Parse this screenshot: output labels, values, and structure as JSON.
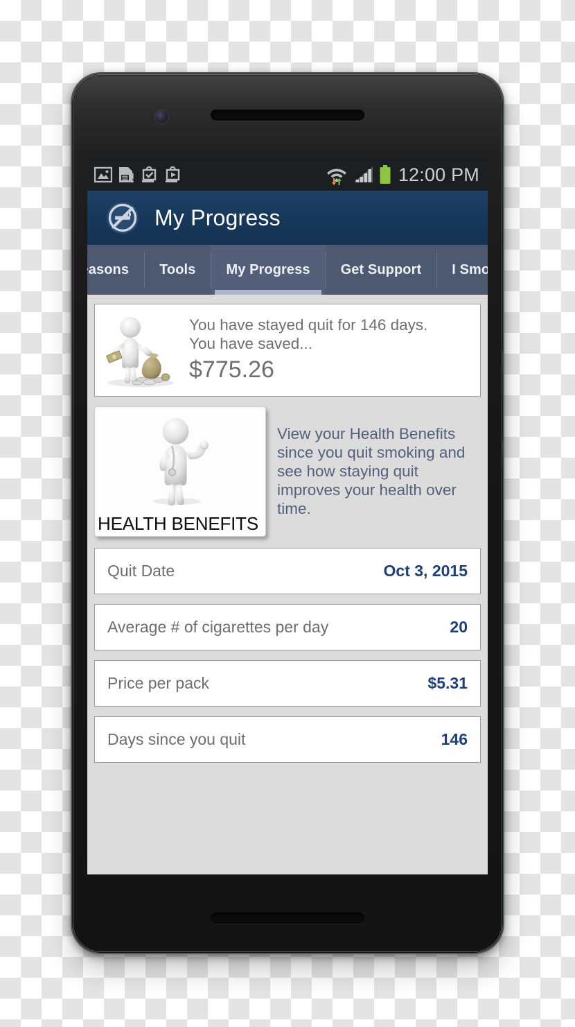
{
  "device": {
    "camera_icon": "front-camera",
    "speaker_icon": "earpiece-speaker"
  },
  "statusbar": {
    "time": "12:00 PM",
    "left_icons": [
      "gallery-image-icon",
      "sim-card-warning-icon",
      "update-check-bag-icon",
      "play-store-bag-icon"
    ],
    "right_icons": [
      "wifi-transfer-icon",
      "cell-signal-icon",
      "battery-full-icon"
    ],
    "colors": {
      "background": "#1c1f22",
      "text": "#cdd0d2",
      "battery": "#8ec63f",
      "arrow_down": "#f0932b",
      "arrow_up": "#7ec13f"
    }
  },
  "appbar": {
    "title": "My Progress",
    "logo_icon": "no-smoking-icon",
    "color": "#17375a"
  },
  "tabs": [
    {
      "label": "Reasons",
      "active": false,
      "partial": true
    },
    {
      "label": "Tools",
      "active": false,
      "partial": false
    },
    {
      "label": "My Progress",
      "active": true,
      "partial": false
    },
    {
      "label": "Get Support",
      "active": false,
      "partial": false
    },
    {
      "label": "I Smoke",
      "active": false,
      "partial": true
    }
  ],
  "tabbar_colors": {
    "background": "#4d5871",
    "active_background": "#54607a",
    "indicator": "#aeb6c7",
    "label": "#eef0f4"
  },
  "savings_card": {
    "figure_icon": "person-with-money-bag-illustration",
    "line1": "You have stayed quit for 146 days.",
    "line2": "You have saved...",
    "amount": "$775.26"
  },
  "health_benefits": {
    "thumb_icon": "person-with-stethoscope-illustration",
    "caption": "HEALTH BENEFITS",
    "description": "View your Health Benefits since you quit smoking and see how staying quit improves your health over time."
  },
  "stats": [
    {
      "label": "Quit Date",
      "value": "Oct 3, 2015"
    },
    {
      "label": "Average # of cigarettes per day",
      "value": "20"
    },
    {
      "label": "Price per pack",
      "value": "$5.31"
    },
    {
      "label": "Days since you quit",
      "value": "146"
    }
  ],
  "content_colors": {
    "background": "#dcdcdc",
    "card": "#ffffff",
    "card_border": "#9b9b9b",
    "label": "#6d6d6d",
    "value": "#1f3f7a",
    "description": "#54607a"
  }
}
